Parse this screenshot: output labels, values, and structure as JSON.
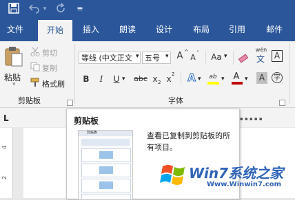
{
  "quick_access": {
    "save_icon": "save-icon",
    "undo_icon": "undo-icon",
    "redo_icon": "redo-icon",
    "customize_icon": "customize-icon"
  },
  "tabs": [
    {
      "label": "文件"
    },
    {
      "label": "开始"
    },
    {
      "label": "插入"
    },
    {
      "label": "朗读"
    },
    {
      "label": "设计"
    },
    {
      "label": "布局"
    },
    {
      "label": "引用"
    },
    {
      "label": "邮件"
    }
  ],
  "clipboard": {
    "paste_label": "粘贴",
    "cut_label": "剪切",
    "copy_label": "复制",
    "format_painter_label": "格式刷",
    "group_label": "剪贴板"
  },
  "font": {
    "font_name": "等线 (中文正文",
    "font_size": "五号",
    "group_label": "字体",
    "grow_label": "A",
    "shrink_label": "A",
    "case_label": "Aa",
    "phonetic_label": "wén",
    "border_label": "A",
    "bold_label": "B",
    "italic_label": "I",
    "underline_label": "U",
    "strike_label": "abc",
    "subscript_label": "x",
    "superscript_label": "x",
    "effects_label": "A",
    "highlight_label": "ab",
    "font_color_label": "A",
    "shading_label": "A",
    "enclose_label": "字"
  },
  "ruler": {
    "tab_selector": "L",
    "v_marks": [
      "4",
      "2"
    ]
  },
  "tooltip": {
    "title": "剪贴板",
    "description": "查看已复制到剪贴板的所有项目。",
    "preview_title": "剪贴板"
  },
  "watermark": {
    "brand": "Win7系统之家",
    "url": "Www.Winwin7.com"
  },
  "colors": {
    "accent": "#2b579a",
    "highlight": "#ffff00",
    "font_color": "#c00000"
  }
}
